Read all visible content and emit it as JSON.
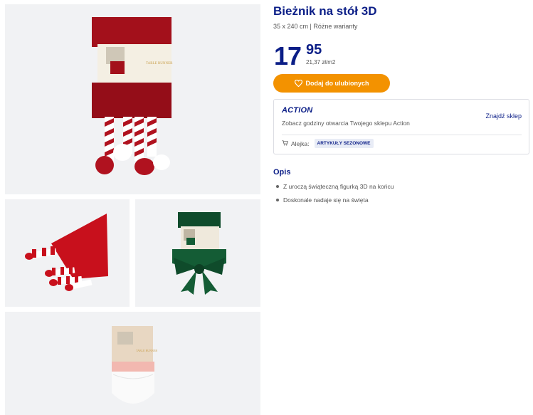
{
  "product": {
    "title": "Bieżnik na stół 3D",
    "subtitle": "35 x 240 cm | Różne warianty",
    "price_int": "17",
    "price_dec": "95",
    "unit_price": "21,37 zł/m2",
    "favorite_label": "Dodaj do ulubionych"
  },
  "store": {
    "brand": "ACTION",
    "find_label": "Znajdź sklep",
    "hours_text": "Zobacz godziny otwarcia Twojego sklepu Action",
    "aisle_label": "Alejka:",
    "aisle_value": "ARTYKUŁY SEZONOWE"
  },
  "description": {
    "title": "Opis",
    "items": [
      "Z uroczą świąteczną figurką 3D na końcu",
      "Doskonale nadaje się na święta"
    ]
  },
  "gallery": {
    "images": [
      "product-main-red-runner",
      "product-red-runner-laid-out",
      "product-green-bow-variant",
      "product-santa-variant"
    ]
  },
  "colors": {
    "brand_blue": "#0b1e87",
    "accent_orange": "#f39200",
    "tile_bg": "#f1f2f4"
  }
}
